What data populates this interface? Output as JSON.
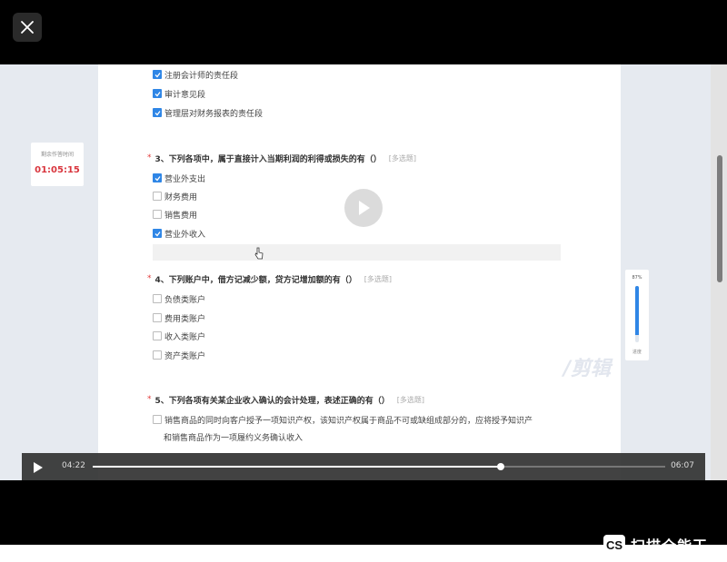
{
  "timer": {
    "label": "剩余作答时间",
    "value": "01:05:15"
  },
  "progress": {
    "percent_label": "87%",
    "value": 0.87,
    "caption": "进度"
  },
  "options_top": [
    {
      "label": "注册会计师的责任段",
      "checked": true
    },
    {
      "label": "审计意见段",
      "checked": true
    },
    {
      "label": "管理层对财务报表的责任段",
      "checked": true
    }
  ],
  "q3": {
    "title": "3、下列各项中，属于直接计入当期利润的利得或损失的有（）",
    "tag": "[多选题]",
    "options": [
      {
        "label": "营业外支出",
        "checked": true
      },
      {
        "label": "财务费用",
        "checked": false
      },
      {
        "label": "销售费用",
        "checked": false
      },
      {
        "label": "营业外收入",
        "checked": true
      }
    ]
  },
  "q4": {
    "title": "4、下列账户中，借方记减少额，贷方记增加额的有（）",
    "tag": "[多选题]",
    "options": [
      {
        "label": "负债类账户",
        "checked": false
      },
      {
        "label": "费用类账户",
        "checked": false
      },
      {
        "label": "收入类账户",
        "checked": false
      },
      {
        "label": "资产类账户",
        "checked": false
      }
    ]
  },
  "q5": {
    "title": "5、下列各项有关某企业收入确认的会计处理，表述正确的有（）",
    "tag": "[多选题]",
    "options": [
      {
        "label": "销售商品的同时向客户授予一项知识产权，该知识产权属于商品不可或缺组成部分的，应将授予知识产",
        "line2": "和销售商品作为一项履约义务确认收入",
        "checked": false
      }
    ]
  },
  "watermark": "/剪辑",
  "player": {
    "current_time": "04:22",
    "total_time": "06:07",
    "played_fraction": 0.713
  },
  "brand": {
    "badge": "CS",
    "name": "扫描全能王"
  }
}
